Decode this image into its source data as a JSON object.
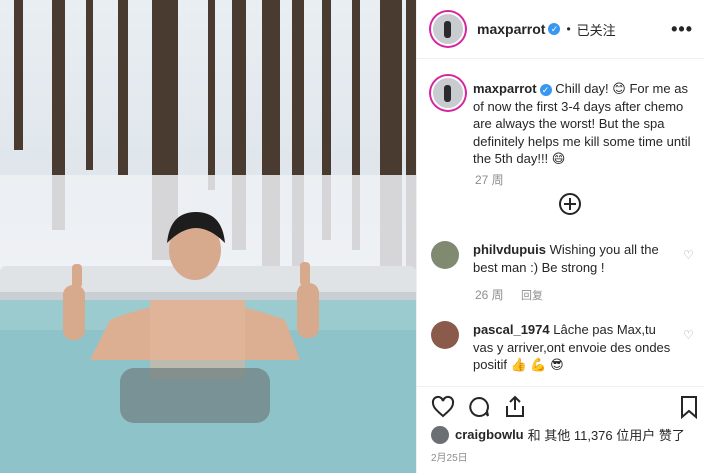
{
  "post": {
    "username": "maxparrot",
    "header_separator": "•",
    "follow_status": "已关注",
    "more_label": "•••"
  },
  "caption": {
    "username": "maxparrot",
    "text": "Chill day! 😊  For me as of now the first 3-4 days after chemo are always the worst! But the spa definitely helps me kill some time until the 5th day!!! 😄",
    "time": "27 周"
  },
  "comments": [
    {
      "username": "philvdupuis",
      "text": "Wishing you all the best man :) Be strong !",
      "time": "26 周",
      "reply": "回复"
    },
    {
      "username": "pascal_1974",
      "text": "Lâche pas Max,tu vas y arriver,ont envoie des ondes positif 👍 💪 😎"
    }
  ],
  "likes": {
    "username": "craigbowlu",
    "text": "和 其他 11,376 位用户 赞了"
  },
  "date": "2月25日",
  "colors": {
    "verified": "#3897f0",
    "ring": "#d6249f",
    "water": "#8cc3c8"
  },
  "icons": [
    "verified-badge-icon",
    "more-options-icon",
    "load-more-icon",
    "heart-icon",
    "comment-icon",
    "share-icon",
    "bookmark-icon"
  ]
}
